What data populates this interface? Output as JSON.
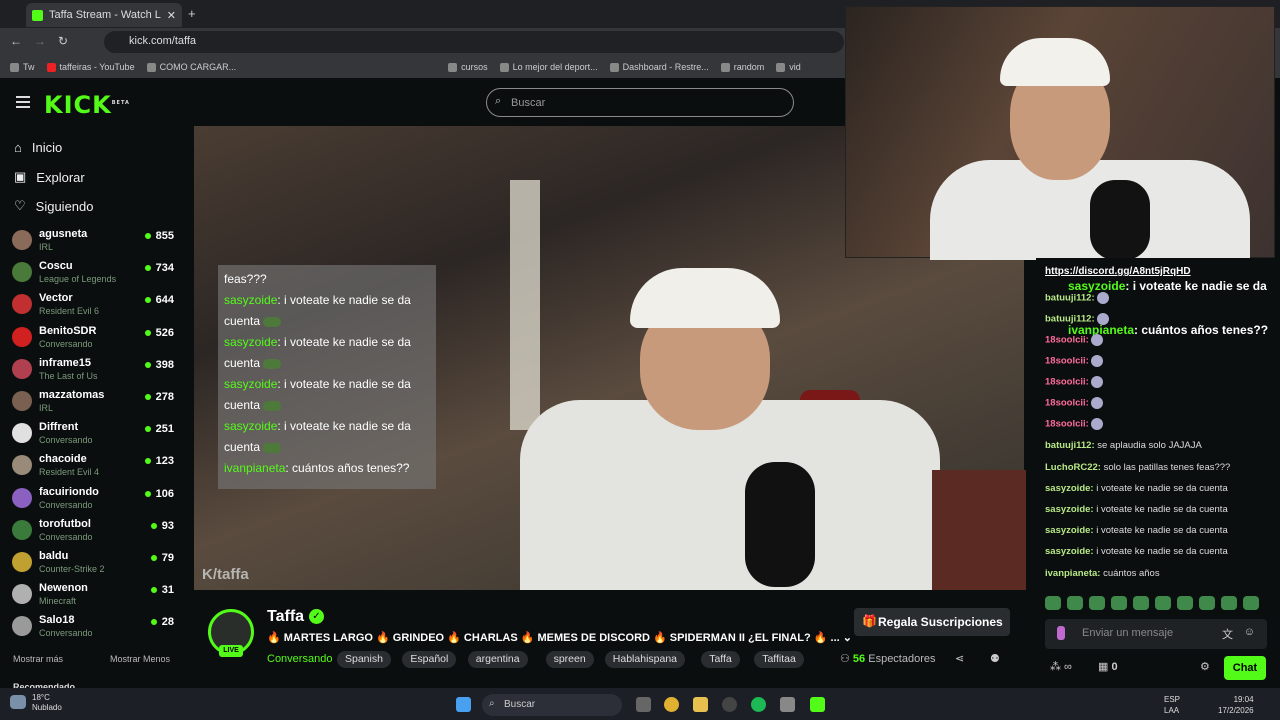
{
  "browser": {
    "tab_title": "Taffa Stream - Watch Live o",
    "url": "kick.com/taffa",
    "bookmarks": [
      "Tw",
      "taffeiras - YouTube",
      "COMO CARGAR...",
      "cursos",
      "Lo mejor del deport...",
      "Dashboard - Restre...",
      "random",
      "vid"
    ]
  },
  "header": {
    "logo": "KICK",
    "logo_sup": "BETA",
    "search_placeholder": "Buscar"
  },
  "sidebar": {
    "nav": [
      {
        "icon": "home-icon",
        "label": "Inicio"
      },
      {
        "icon": "explore-icon",
        "label": "Explorar"
      },
      {
        "icon": "heart-icon",
        "label": "Siguiendo"
      }
    ],
    "channels": [
      {
        "name": "agusneta",
        "game": "IRL",
        "viewers": "855",
        "color": "#8a6b5a"
      },
      {
        "name": "Coscu",
        "game": "League of Legends",
        "viewers": "734",
        "color": "#4a7a3a"
      },
      {
        "name": "Vector",
        "game": "Resident Evil 6",
        "viewers": "644",
        "color": "#c03030"
      },
      {
        "name": "BenitoSDR",
        "game": "Conversando",
        "viewers": "526",
        "color": "#d02020"
      },
      {
        "name": "inframe15",
        "game": "The Last of Us",
        "viewers": "398",
        "color": "#b04050"
      },
      {
        "name": "mazzatomas",
        "game": "IRL",
        "viewers": "278",
        "color": "#7a6050"
      },
      {
        "name": "Diffrent",
        "game": "Conversando",
        "viewers": "251",
        "color": "#e0e0e0"
      },
      {
        "name": "chacoide",
        "game": "Resident Evil 4",
        "viewers": "123",
        "color": "#9a8a7a"
      },
      {
        "name": "facuiriondo",
        "game": "Conversando",
        "viewers": "106",
        "color": "#8a60c0"
      },
      {
        "name": "torofutbol",
        "game": "Conversando",
        "viewers": "93",
        "color": "#3a7a3a"
      },
      {
        "name": "baldu",
        "game": "Counter-Strike 2",
        "viewers": "79",
        "color": "#c0a030"
      },
      {
        "name": "Newenon",
        "game": "Minecraft",
        "viewers": "31",
        "color": "#b0b0b0"
      },
      {
        "name": "Salo18",
        "game": "Conversando",
        "viewers": "28",
        "color": "#9a9a9a"
      }
    ],
    "show_more": "Mostrar más",
    "show_less": "Mostrar Menos",
    "recommended": "Recomendado"
  },
  "video": {
    "watermark": "K/taffa",
    "overlay_chat": [
      {
        "user": "",
        "text": "feas???",
        "emote": false
      },
      {
        "user": "sasyzoide",
        "text": ": i voteate ke nadie se da cuenta",
        "emote": true
      },
      {
        "user": "sasyzoide",
        "text": ": i voteate ke nadie se da cuenta",
        "emote": true
      },
      {
        "user": "sasyzoide",
        "text": ": i voteate ke nadie se da cuenta",
        "emote": true
      },
      {
        "user": "sasyzoide",
        "text": ": i voteate ke nadie se da cuenta",
        "emote": true
      },
      {
        "user": "ivanpianeta",
        "text": ": cuántos años tenes??",
        "emote": false
      }
    ]
  },
  "stream_info": {
    "channel_name": "Taffa",
    "live_badge": "LIVE",
    "title": "🔥 MARTES LARGO 🔥 GRINDEO 🔥 CHARLAS 🔥 MEMES DE DISCORD 🔥 SPIDERMAN II ¿EL FINAL? 🔥 ...",
    "category": "Conversando",
    "tags": [
      "Spanish",
      "Español",
      "argentina",
      "spreen",
      "Hablahispana",
      "Taffa",
      "Taffitaa"
    ],
    "gift_button": "Regala Suscripciones",
    "viewer_count": "56",
    "viewer_label": "Espectadores"
  },
  "chat": {
    "link": "https://discord.gg/A8nt5jRqHD",
    "big_messages": [
      {
        "user": "sasyzoide",
        "text": ": i voteate ke nadie se da",
        "color": "#53fc18"
      },
      {
        "user": "ivanpianeta",
        "text": ": cuántos años tenes??",
        "color": "#53fc18"
      }
    ],
    "messages": [
      {
        "user": "batuuji112:",
        "text": "",
        "color": "#b8e986"
      },
      {
        "user": "batuuji112:",
        "text": "",
        "color": "#b8e986"
      },
      {
        "user": "18soolcii:",
        "text": "",
        "color": "#ff6b9a"
      },
      {
        "user": "18soolcii:",
        "text": "",
        "color": "#ff6b9a"
      },
      {
        "user": "18soolcii:",
        "text": "",
        "color": "#ff6b9a"
      },
      {
        "user": "18soolcii:",
        "text": "",
        "color": "#ff6b9a"
      },
      {
        "user": "18soolcii:",
        "text": "",
        "color": "#ff6b9a"
      },
      {
        "user": "batuuji112:",
        "text": " se aplaudia solo JAJAJA",
        "color": "#b8e986"
      },
      {
        "user": "LuchoRC22:",
        "text": " solo las patillas tenes feas???",
        "color": "#b8e986"
      },
      {
        "user": "sasyzoide:",
        "text": " i voteate ke nadie se da cuenta",
        "color": "#b8e986"
      },
      {
        "user": "sasyzoide:",
        "text": " i voteate ke nadie se da cuenta",
        "color": "#b8e986"
      },
      {
        "user": "sasyzoide:",
        "text": " i voteate ke nadie se da cuenta",
        "color": "#b8e986"
      },
      {
        "user": "sasyzoide:",
        "text": " i voteate ke nadie se da cuenta",
        "color": "#b8e986"
      },
      {
        "user": "ivanpianeta:",
        "text": " cuántos años",
        "color": "#b8e986"
      }
    ],
    "input_placeholder": "Enviar un mensaje",
    "points": "0",
    "chat_button": "Chat"
  },
  "taskbar": {
    "temp": "18°C",
    "weather": "Nublado",
    "search": "Buscar",
    "lang1": "ESP",
    "lang2": "LAA",
    "time": "19:04",
    "date": "17/2/2026"
  }
}
